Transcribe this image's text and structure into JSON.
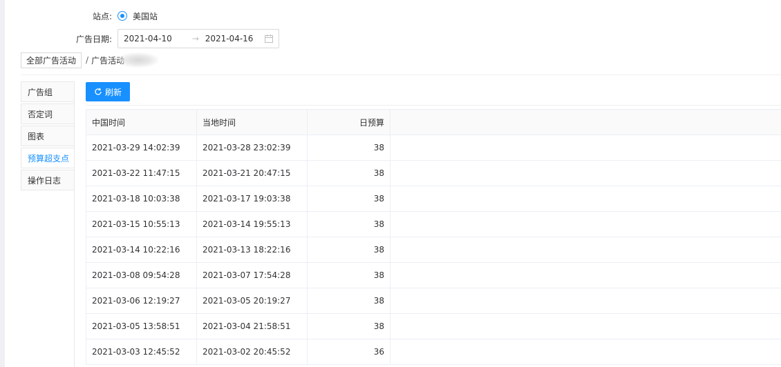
{
  "filters": {
    "site_label": "站点:",
    "site_value": "美国站",
    "date_label": "广告日期:",
    "date_start": "2021-04-10",
    "date_separator": "→",
    "date_end": "2021-04-16"
  },
  "breadcrumb": {
    "root": "全部广告活动",
    "separator": "/",
    "current": "广告活动"
  },
  "side_tabs": [
    {
      "label": "广告组",
      "active": false
    },
    {
      "label": "否定词",
      "active": false
    },
    {
      "label": "图表",
      "active": false
    },
    {
      "label": "预算超支点",
      "active": true
    },
    {
      "label": "操作日志",
      "active": false
    }
  ],
  "toolbar": {
    "refresh_label": "刷新",
    "accent_color": "#1890ff"
  },
  "table": {
    "headers": [
      "中国时间",
      "当地时间",
      "日预算"
    ],
    "rows": [
      [
        "2021-03-29 14:02:39",
        "2021-03-28 23:02:39",
        "38"
      ],
      [
        "2021-03-22 11:47:15",
        "2021-03-21 20:47:15",
        "38"
      ],
      [
        "2021-03-18 10:03:38",
        "2021-03-17 19:03:38",
        "38"
      ],
      [
        "2021-03-15 10:55:13",
        "2021-03-14 19:55:13",
        "38"
      ],
      [
        "2021-03-14 10:22:16",
        "2021-03-13 18:22:16",
        "38"
      ],
      [
        "2021-03-08 09:54:28",
        "2021-03-07 17:54:28",
        "38"
      ],
      [
        "2021-03-06 12:19:27",
        "2021-03-05 20:19:27",
        "38"
      ],
      [
        "2021-03-05 13:58:51",
        "2021-03-04 21:58:51",
        "38"
      ],
      [
        "2021-03-03 12:45:52",
        "2021-03-02 20:45:52",
        "36"
      ]
    ]
  }
}
